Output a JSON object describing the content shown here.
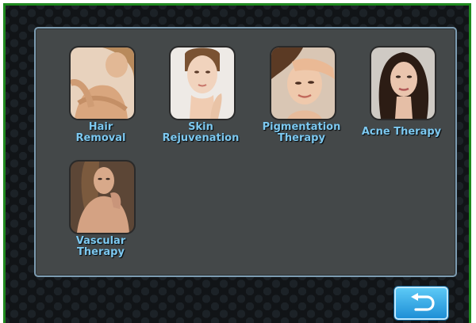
{
  "menu": {
    "items": [
      {
        "label": "Hair\nRemoval"
      },
      {
        "label": "Skin\nRejuvenation"
      },
      {
        "label": "Pigmentation\nTherapy"
      },
      {
        "label": "Acne Therapy"
      },
      {
        "label": "Vascular\nTherapy"
      }
    ]
  },
  "icons": {
    "back": "return-arrow-icon"
  },
  "colors": {
    "frame_border": "#1f8a1f",
    "panel_border": "#7d9cb1",
    "label_text": "#7ec8ef",
    "back_button": "#1e8fd6"
  }
}
